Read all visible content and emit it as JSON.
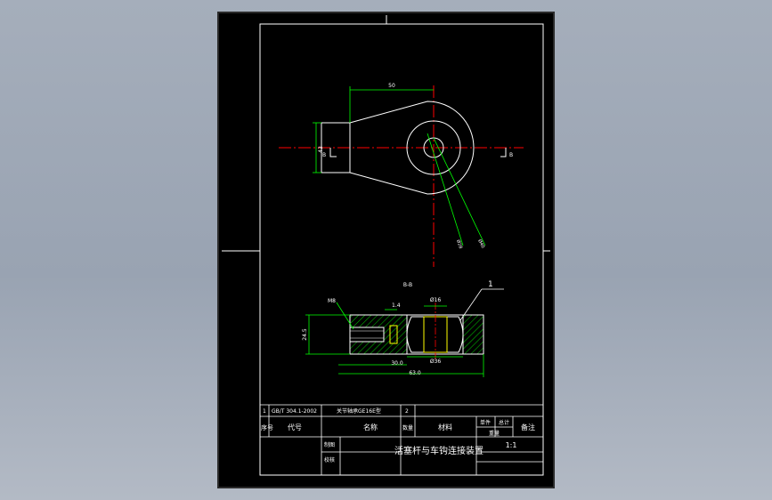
{
  "colors": {
    "background": "#000000",
    "outline": "#ffffff",
    "centerline": "#ff0000",
    "dimension": "#00ff00",
    "hatch": "#00ff00",
    "accent_yellow": "#ffff00"
  },
  "top_view": {
    "dim_top": "50",
    "dim_left": "43",
    "dim_diag_1": "Ø28",
    "dim_diag_2": "Ø40",
    "section_mark_left": "B",
    "section_mark_right": "B"
  },
  "section_view": {
    "title": "B-B",
    "balloon": "1",
    "dim_left_label": "M8",
    "dim_1_4": "1.4",
    "dim_phi": "Ø16",
    "dim_height": "24.5",
    "dim_phi_bottom": "Ø36",
    "dim_30": "30.0",
    "dim_63": "63.0"
  },
  "bom_row": {
    "index": "1",
    "code": "GB/T 304.1-2002",
    "name": "关节轴承GE16E型",
    "qty": "2"
  },
  "header_row": {
    "col_index": "序号",
    "col_code": "代号",
    "col_name": "名称",
    "col_qty": "数量",
    "col_material": "材料",
    "col_unit_weight": "单件",
    "col_total_weight": "总计",
    "col_weight": "重量",
    "col_remark": "备注"
  },
  "title_block": {
    "title": "活塞杆与车钩连接装置",
    "scale": "1:1",
    "designer_label": "制图",
    "checker_label": "校核"
  }
}
